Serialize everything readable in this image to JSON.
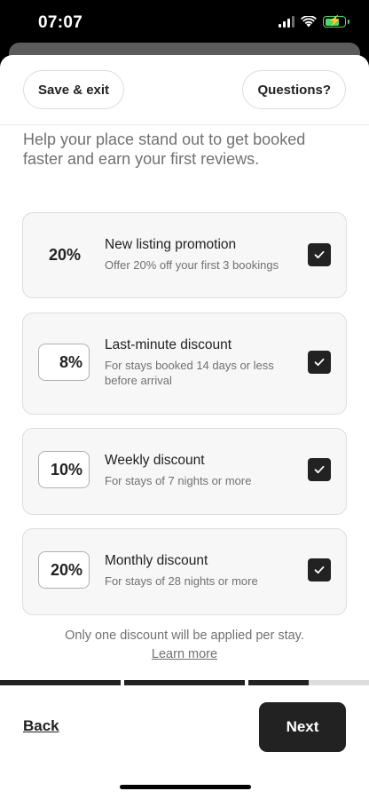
{
  "status_bar": {
    "time": "07:07"
  },
  "header": {
    "save_exit_label": "Save & exit",
    "questions_label": "Questions?"
  },
  "intro_text": "Help your place stand out to get booked faster and earn your first reviews.",
  "discounts": [
    {
      "percent": "20%",
      "title": "New listing promotion",
      "description": "Offer 20% off your first 3 bookings",
      "editable": false,
      "checked": true
    },
    {
      "percent": "8%",
      "title": "Last-minute discount",
      "description": "For stays booked 14 days or less before arrival",
      "editable": true,
      "checked": true
    },
    {
      "percent": "10%",
      "title": "Weekly discount",
      "description": "For stays of 7 nights or more",
      "editable": true,
      "checked": true
    },
    {
      "percent": "20%",
      "title": "Monthly discount",
      "description": "For stays of 28 nights or more",
      "editable": true,
      "checked": true
    }
  ],
  "footnote": "Only one discount will be applied per stay.",
  "learn_more_label": "Learn more",
  "progress": {
    "segment_fill": [
      1,
      1,
      0.5
    ]
  },
  "footer": {
    "back_label": "Back",
    "next_label": "Next"
  },
  "colors": {
    "accent": "#222222",
    "muted_text": "#717171",
    "card_bg": "#f7f7f7",
    "battery_green": "#4cd964"
  }
}
